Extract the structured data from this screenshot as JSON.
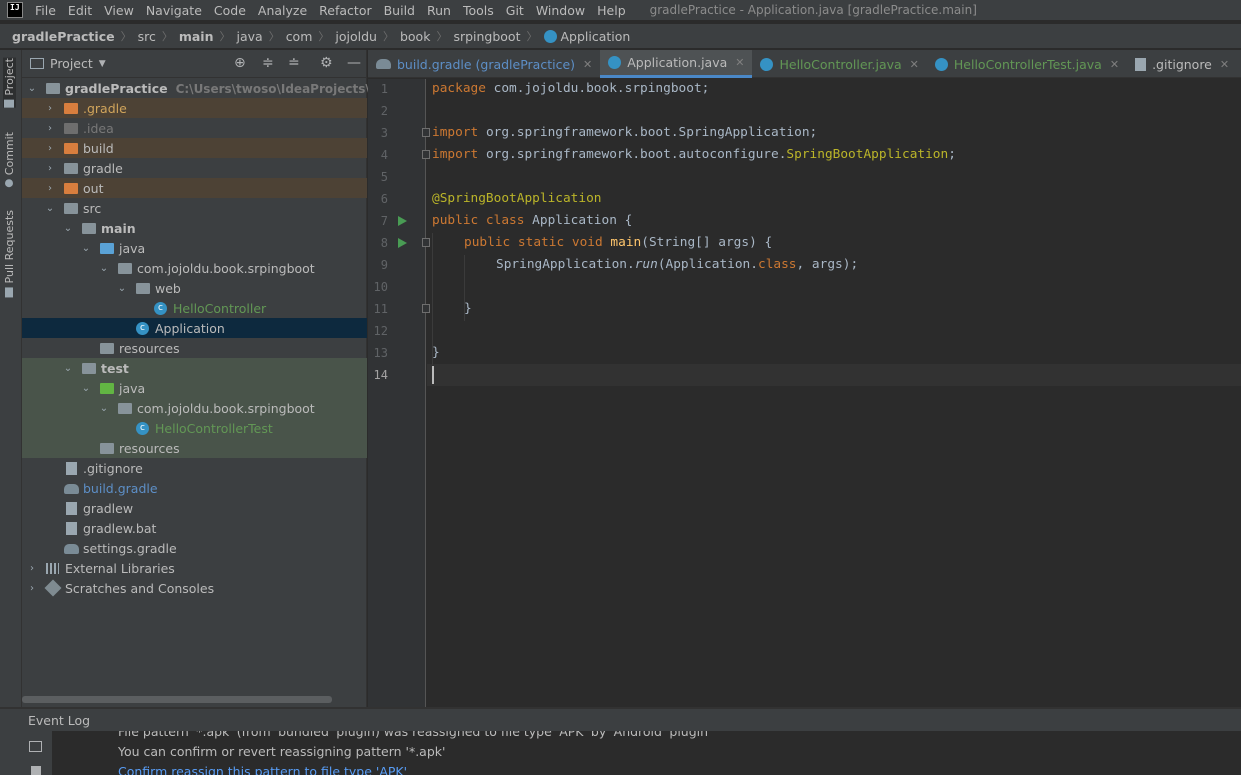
{
  "menubar": {
    "logo": "IJ",
    "items": [
      "File",
      "Edit",
      "View",
      "Navigate",
      "Code",
      "Analyze",
      "Refactor",
      "Build",
      "Run",
      "Tools",
      "Git",
      "Window",
      "Help"
    ],
    "window_title": "gradlePractice - Application.java [gradlePractice.main]"
  },
  "breadcrumb": {
    "items": [
      "gradlePractice",
      "src",
      "main",
      "java",
      "com",
      "jojoldu",
      "book",
      "srpingboot",
      "Application"
    ]
  },
  "stripe": {
    "project": "Project",
    "commit": "Commit",
    "pull_requests": "Pull Requests"
  },
  "project_panel": {
    "title": "Project",
    "tree": [
      {
        "label": "gradlePractice",
        "sub": "C:\\Users\\twoso\\IdeaProjects\\gradleP"
      },
      {
        "label": ".gradle"
      },
      {
        "label": ".idea"
      },
      {
        "label": "build"
      },
      {
        "label": "gradle"
      },
      {
        "label": "out"
      },
      {
        "label": "src"
      },
      {
        "label": "main"
      },
      {
        "label": "java"
      },
      {
        "label": "com.jojoldu.book.srpingboot"
      },
      {
        "label": "web"
      },
      {
        "label": "HelloController"
      },
      {
        "label": "Application"
      },
      {
        "label": "resources"
      },
      {
        "label": "test"
      },
      {
        "label": "java"
      },
      {
        "label": "com.jojoldu.book.srpingboot"
      },
      {
        "label": "HelloControllerTest"
      },
      {
        "label": "resources"
      },
      {
        "label": ".gitignore"
      },
      {
        "label": "build.gradle"
      },
      {
        "label": "gradlew"
      },
      {
        "label": "gradlew.bat"
      },
      {
        "label": "settings.gradle"
      },
      {
        "label": "External Libraries"
      },
      {
        "label": "Scratches and Consoles"
      }
    ]
  },
  "editor_tabs": [
    {
      "label": "build.gradle (gradlePractice)",
      "icon": "gradle-icon",
      "color": "#5d8fc7"
    },
    {
      "label": "Application.java",
      "icon": "class-icon",
      "color": "#bbbbbb"
    },
    {
      "label": "HelloController.java",
      "icon": "class-icon",
      "color": "#629755"
    },
    {
      "label": "HelloControllerTest.java",
      "icon": "class-icon",
      "color": "#629755"
    },
    {
      "label": ".gitignore",
      "icon": "file-icon",
      "color": "#bbbbbb"
    }
  ],
  "editor": {
    "line_numbers": [
      "1",
      "2",
      "3",
      "4",
      "5",
      "6",
      "7",
      "8",
      "9",
      "10",
      "11",
      "12",
      "13",
      "14"
    ],
    "code": {
      "l1_kw": "package",
      "l1_rest": " com.jojoldu.book.srpingboot;",
      "l3_kw": "import",
      "l3_rest": " org.springframework.boot.SpringApplication;",
      "l4_kw": "import",
      "l4_rest": " org.springframework.boot.autoconfigure.",
      "l4_ann": "SpringBootApplication",
      "l4_end": ";",
      "l6_ann": "@SpringBootApplication",
      "l7_kw": "public class",
      "l7_rest": " Application {",
      "l8_kw": "public static void",
      "l8_fn": "main",
      "l8_rest": "(String[] args) {",
      "l9_a": "SpringApplication.",
      "l9_run": "run",
      "l9_b": "(Application.",
      "l9_kw": "class",
      "l9_c": ", args);",
      "l11": "}",
      "l13": "}"
    }
  },
  "event_log": {
    "title": "Event Log",
    "line1": "File pattern '*.apk' (from 'bundled' plugin) was reassigned to file type 'APK' by 'Android' plugin",
    "line2": "You can confirm or revert reassigning pattern '*.apk'",
    "line3": "Confirm reassign this pattern to file type 'APK'"
  }
}
